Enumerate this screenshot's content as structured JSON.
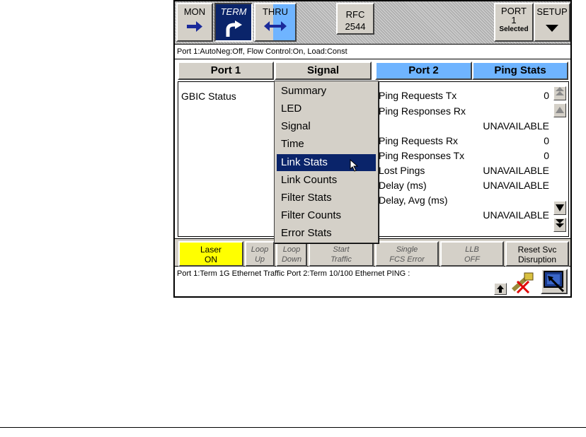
{
  "toolbar": {
    "mon_label": "MON",
    "term_label": "TERM",
    "thru_label": "THRU",
    "rfc_label_1": "RFC",
    "rfc_label_2": "2544",
    "port_label_1": "PORT",
    "port_label_2": "1",
    "port_label_3": "Selected",
    "setup_label": "SETUP"
  },
  "status_line": "Port 1:AutoNeg:Off, Flow Control:On, Load:Const",
  "left_header": {
    "port_label": "Port 1",
    "view_label": "Signal"
  },
  "right_header": {
    "port_label": "Port 2",
    "view_label": "Ping Stats"
  },
  "left_panel": {
    "gbic_label": "GBIC Status"
  },
  "dropdown": {
    "items": [
      "Summary",
      "LED",
      "Signal",
      "Time",
      "Link Stats",
      "Link Counts",
      "Filter Stats",
      "Filter Counts",
      "Error Stats"
    ],
    "selected": "Link Stats"
  },
  "ping_stats": {
    "req_tx_label": "Ping Requests Tx",
    "req_tx_value": "0",
    "resp_rx_label": "Ping Responses Rx",
    "resp_rx_value": "UNAVAILABLE",
    "req_rx_label": "Ping Requests Rx",
    "req_rx_value": "0",
    "resp_tx_label": "Ping Responses Tx",
    "resp_tx_value": "0",
    "lost_label": "Lost Pings",
    "lost_value": "UNAVAILABLE",
    "delay_label": "Delay (ms)",
    "delay_value": "UNAVAILABLE",
    "delay_avg_label": "Delay, Avg (ms)",
    "delay_avg_value": "UNAVAILABLE"
  },
  "action_buttons": {
    "laser_1": "Laser",
    "laser_2": "ON",
    "loop_up_1": "Loop",
    "loop_up_2": "Up",
    "loop_down_1": "Loop",
    "loop_down_2": "Down",
    "start_1": "Start",
    "start_2": "Traffic",
    "fcs_1": "Single",
    "fcs_2": "FCS Error",
    "llb_1": "LLB",
    "llb_2": "OFF",
    "reset_1": "Reset Svc",
    "reset_2": "Disruption"
  },
  "bottom_status": "Port 1:Term 1G Ethernet Traffic  Port 2:Term 10/100 Ethernet PING  :",
  "colors": {
    "active_tab": "#0a246a",
    "header_blue": "#6fb4ff",
    "laser_on": "#ffff00",
    "menu_highlight": "#0a246a"
  }
}
